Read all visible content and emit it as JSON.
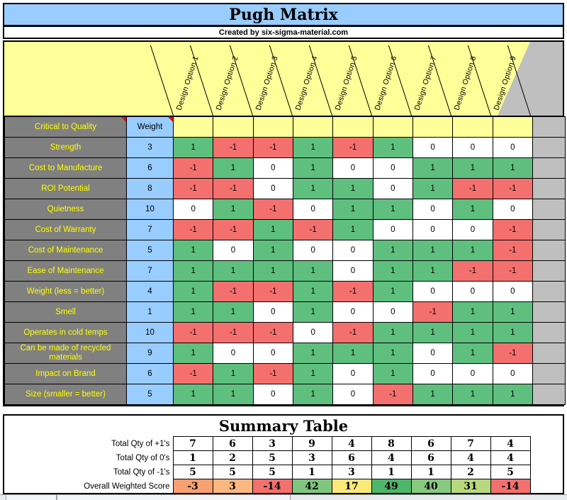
{
  "header": {
    "title": "Pugh Matrix",
    "subtitle": "Created by six-sigma-material.com"
  },
  "matrix": {
    "ctq_header": "Critical to Quality",
    "weight_header": "Weight",
    "options": [
      "Design Option 1",
      "Design Option 2",
      "Design Option 3",
      "Design Option 4",
      "Design Option 5",
      "Design Option 6",
      "Design Option 7",
      "Design Option 8",
      "Design Option 9"
    ],
    "rows": [
      {
        "label": "Strength",
        "weight": "3",
        "scores": [
          "1",
          "-1",
          "-1",
          "1",
          "-1",
          "1",
          "0",
          "0",
          "0"
        ]
      },
      {
        "label": "Cost to Manufacture",
        "weight": "6",
        "scores": [
          "-1",
          "1",
          "0",
          "1",
          "0",
          "0",
          "1",
          "1",
          "1"
        ]
      },
      {
        "label": "ROI Potential",
        "weight": "8",
        "scores": [
          "-1",
          "-1",
          "0",
          "1",
          "1",
          "0",
          "1",
          "-1",
          "-1"
        ]
      },
      {
        "label": "Quietness",
        "weight": "10",
        "scores": [
          "0",
          "1",
          "-1",
          "0",
          "1",
          "1",
          "0",
          "1",
          "0"
        ]
      },
      {
        "label": "Cost of Warranty",
        "weight": "7",
        "scores": [
          "-1",
          "-1",
          "1",
          "-1",
          "1",
          "0",
          "0",
          "0",
          "-1"
        ]
      },
      {
        "label": "Cost of Maintenance",
        "weight": "5",
        "scores": [
          "1",
          "0",
          "1",
          "0",
          "0",
          "1",
          "1",
          "1",
          "-1"
        ]
      },
      {
        "label": "Ease of Maintenance",
        "weight": "7",
        "scores": [
          "1",
          "1",
          "1",
          "1",
          "0",
          "1",
          "1",
          "-1",
          "-1"
        ]
      },
      {
        "label": "Weight (less = better)",
        "weight": "4",
        "scores": [
          "1",
          "-1",
          "-1",
          "1",
          "-1",
          "1",
          "0",
          "0",
          "0"
        ]
      },
      {
        "label": "Smell",
        "weight": "1",
        "scores": [
          "1",
          "1",
          "0",
          "1",
          "0",
          "0",
          "-1",
          "1",
          "1"
        ]
      },
      {
        "label": "Operates in cold temps",
        "weight": "10",
        "scores": [
          "-1",
          "-1",
          "-1",
          "0",
          "-1",
          "1",
          "1",
          "1",
          "1"
        ]
      },
      {
        "label": "Can be made of recycled materials",
        "weight": "9",
        "scores": [
          "1",
          "0",
          "0",
          "1",
          "1",
          "1",
          "0",
          "1",
          "-1"
        ]
      },
      {
        "label": "Impact on Brand",
        "weight": "6",
        "scores": [
          "-1",
          "1",
          "-1",
          "1",
          "0",
          "1",
          "0",
          "0",
          "0"
        ]
      },
      {
        "label": "Size (smaller = better)",
        "weight": "5",
        "scores": [
          "1",
          "1",
          "0",
          "1",
          "0",
          "-1",
          "1",
          "1",
          "1"
        ]
      }
    ]
  },
  "summary": {
    "title": "Summary Table",
    "rows": [
      {
        "label": "Total Qty of +1's",
        "values": [
          "7",
          "6",
          "3",
          "9",
          "4",
          "8",
          "6",
          "7",
          "4"
        ]
      },
      {
        "label": "Total Qty of 0's",
        "values": [
          "1",
          "2",
          "5",
          "3",
          "6",
          "4",
          "6",
          "4",
          "4"
        ]
      },
      {
        "label": "Total Qty of -1's",
        "values": [
          "5",
          "5",
          "5",
          "1",
          "3",
          "1",
          "1",
          "2",
          "5"
        ]
      }
    ],
    "score_row": {
      "label": "Overall Weighted Score",
      "values": [
        "-3",
        "3",
        "-14",
        "42",
        "17",
        "49",
        "40",
        "31",
        "-14"
      ],
      "colors": [
        "#f8a070",
        "#fbb780",
        "#f4706e",
        "#7fc77f",
        "#fde87a",
        "#4eb56b",
        "#86c97f",
        "#b7d87f",
        "#f4706e"
      ]
    }
  },
  "colors": {
    "title_bg": "#99ccff",
    "header_yellow": "#ffff99",
    "label_gray": "#808080",
    "label_text": "#ffff00",
    "weight_blue": "#99ccff",
    "positive": "#5fbf7f",
    "negative": "#f4706e",
    "neutral": "#ffffff",
    "gray_fill": "#bfbfbf"
  }
}
